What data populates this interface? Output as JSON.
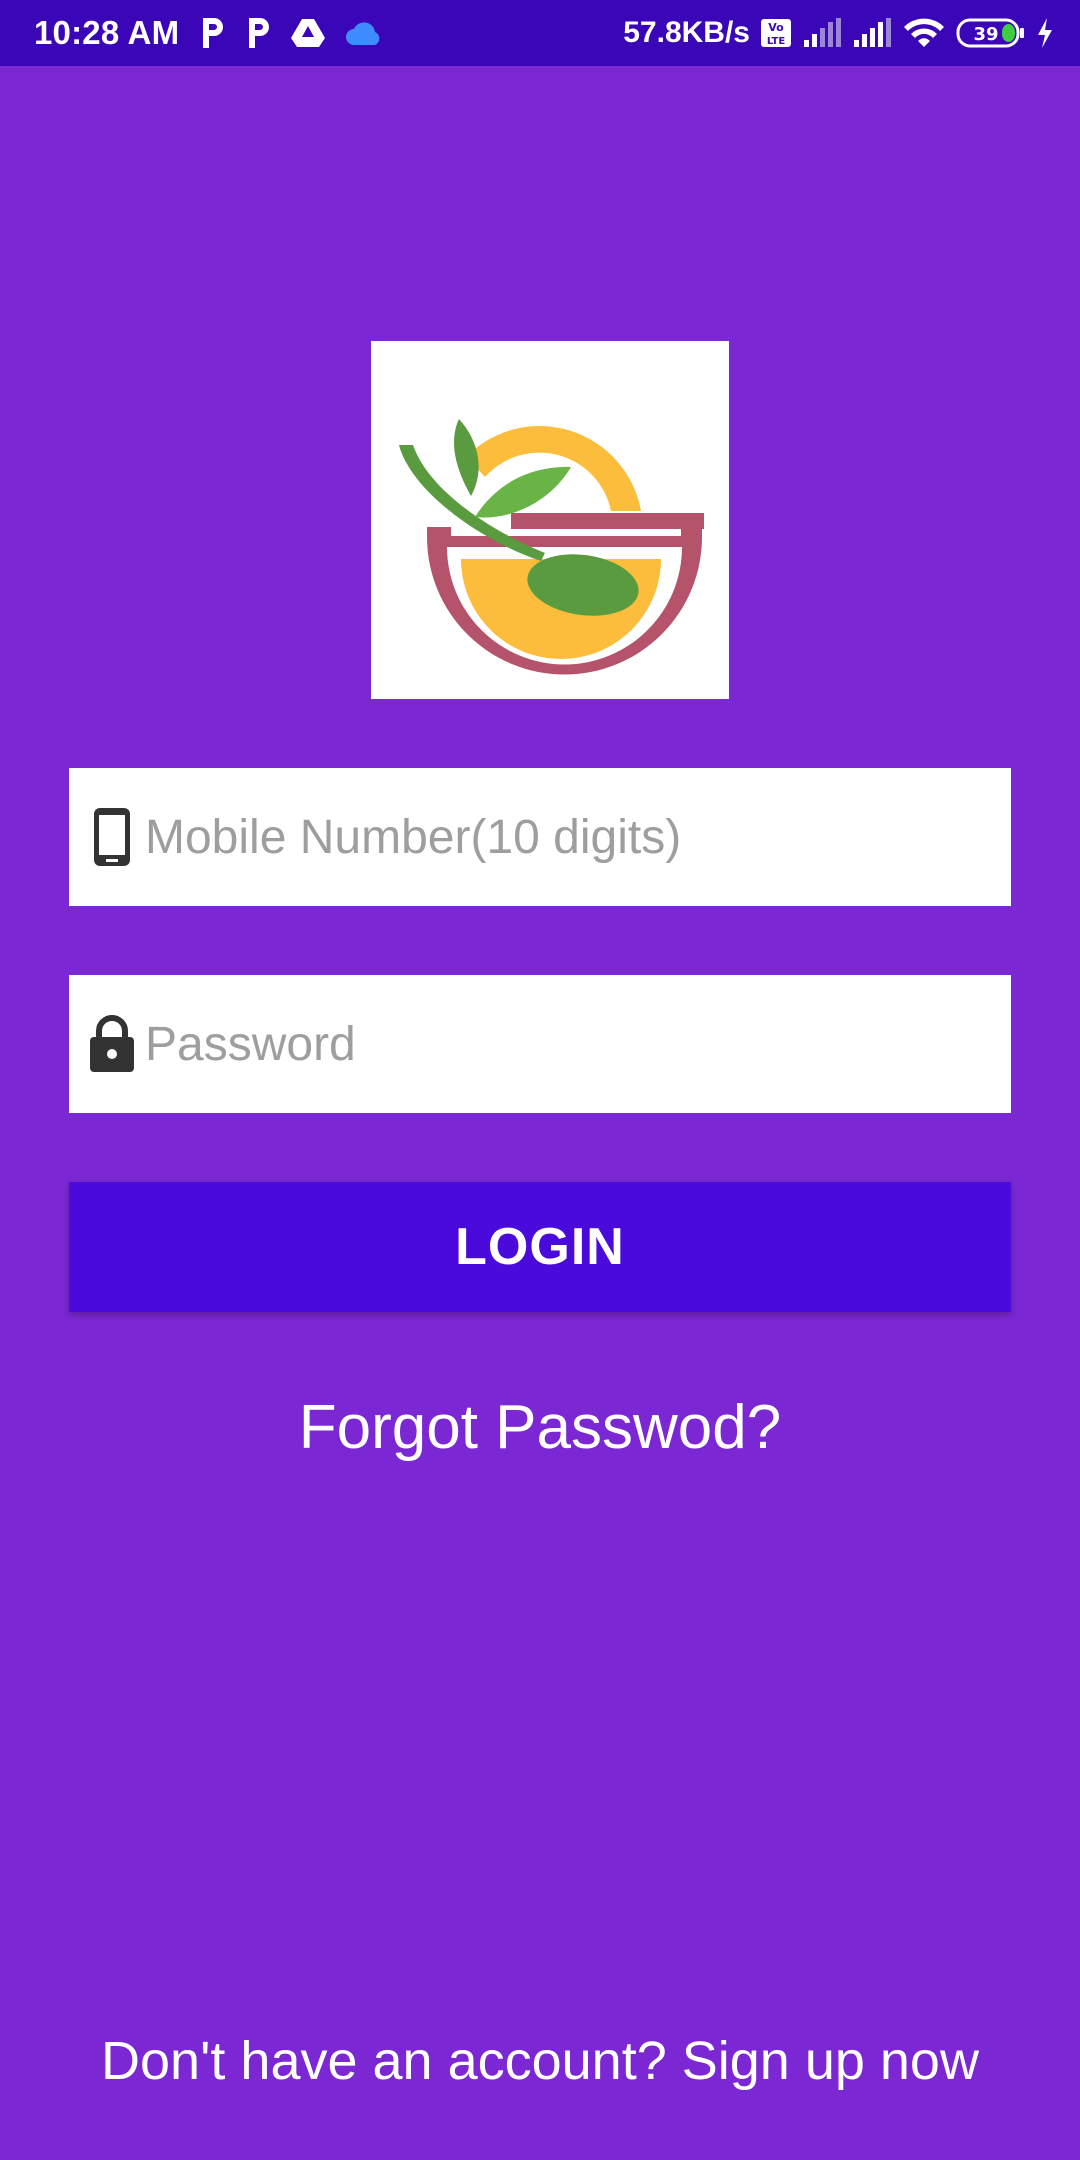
{
  "status_bar": {
    "time": "10:28 AM",
    "net_speed": "57.8KB/s",
    "battery": "39",
    "icons": [
      "parking-icon",
      "parking-icon",
      "drive-icon",
      "cloud-icon",
      "volte-icon",
      "signal-icon",
      "signal-icon",
      "wifi-icon",
      "battery-icon",
      "charging-icon"
    ]
  },
  "login_form": {
    "mobile_placeholder": "Mobile Number(10 digits)",
    "mobile_value": "",
    "password_placeholder": "Password",
    "password_value": "",
    "login_label": "LOGIN",
    "forgot_label": "Forgot Passwod?"
  },
  "footer": {
    "signup_label": "Don't have an account? Sign up now"
  },
  "colors": {
    "background": "#7b27d4",
    "status_bar": "#3b05b8",
    "button": "#4a0adc"
  }
}
